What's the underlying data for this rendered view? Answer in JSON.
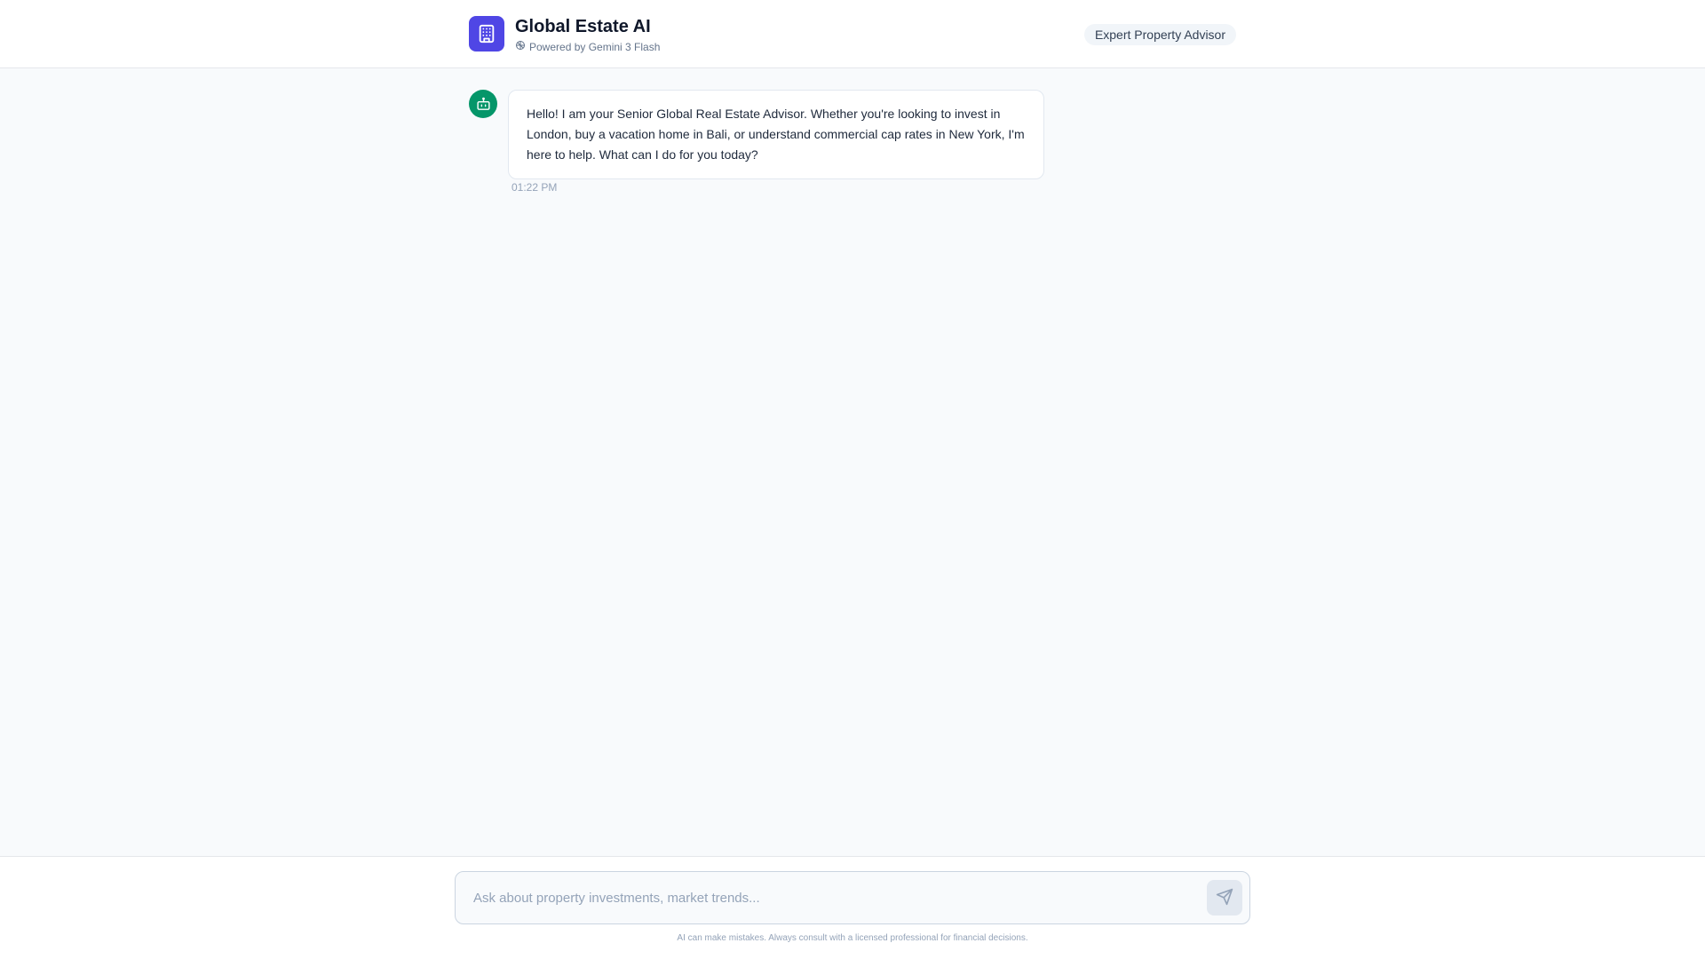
{
  "header": {
    "title": "Global Estate AI",
    "subtitle": "Powered by Gemini 3 Flash",
    "badge": "Expert Property Advisor",
    "logo_icon": "building-icon",
    "subtitle_icon": "sparkle-icon",
    "accent_color": "#4f46e5"
  },
  "chat": {
    "messages": [
      {
        "role": "assistant",
        "avatar_icon": "robot-icon",
        "avatar_color": "#059669",
        "text": "Hello! I am your Senior Global Real Estate Advisor. Whether you're looking to invest in London, buy a vacation home in Bali, or understand commercial cap rates in New York, I'm here to help. What can I do for you today?",
        "time": "01:22 PM"
      }
    ]
  },
  "composer": {
    "placeholder": "Ask about property investments, market trends...",
    "value": "",
    "send_icon": "send-icon"
  },
  "footer": {
    "disclaimer": "AI can make mistakes. Always consult with a licensed professional for financial decisions."
  }
}
